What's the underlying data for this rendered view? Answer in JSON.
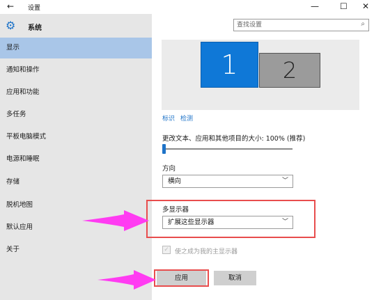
{
  "window": {
    "back_glyph": "←",
    "title": "设置",
    "minimize_glyph": "—",
    "maximize_glyph": "☐",
    "close_glyph": "✕"
  },
  "header": {
    "section_title": "系统",
    "search_placeholder": "查找设置",
    "search_icon": "search-icon",
    "gear_icon": "gear-icon"
  },
  "sidebar": {
    "items": [
      {
        "label": "显示",
        "active": true
      },
      {
        "label": "通知和操作"
      },
      {
        "label": "应用和功能"
      },
      {
        "label": "多任务"
      },
      {
        "label": "平板电脑模式"
      },
      {
        "label": "电源和睡眠"
      },
      {
        "label": "存储"
      },
      {
        "label": "脱机地图"
      },
      {
        "label": "默认应用"
      },
      {
        "label": "关于"
      }
    ]
  },
  "display": {
    "monitor_1": "1",
    "monitor_2": "2",
    "identify_link": "标识",
    "detect_link": "检测",
    "scale_label": "更改文本、应用和其他项目的大小: 100% (推荐)",
    "scale_level_fraction": 0,
    "orientation_label": "方向",
    "orientation_value": "横向",
    "multi_display_label": "多显示器",
    "multi_display_value": "扩展这些显示器",
    "main_display_checkbox": "使之成为我的主显示器",
    "main_display_checked": true,
    "main_display_disabled": true,
    "apply_button": "应用",
    "cancel_button": "取消"
  },
  "colors": {
    "accent": "#1e73c8",
    "monitor_selected": "#0f78d7",
    "monitor_other": "#9b9b9b",
    "annotation_red": "#e84d4d",
    "annotation_arrow": "#ff3cf2",
    "sidebar_bg": "#e6e6e6",
    "sidebar_active": "#a9c6e8"
  }
}
